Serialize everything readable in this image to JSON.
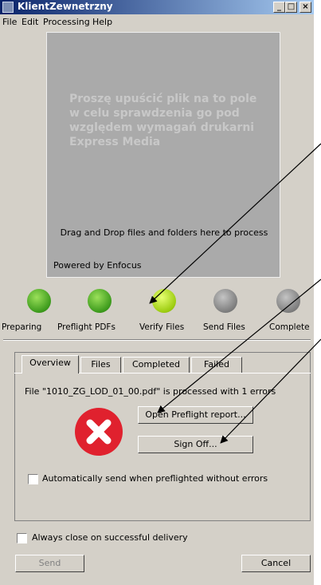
{
  "window": {
    "title": "KlientZewnetrzny",
    "controls": {
      "minimize": "_",
      "maximize": "□",
      "close": "×"
    }
  },
  "menu": [
    "File",
    "Edit",
    "Processing",
    "Help"
  ],
  "dropzone": {
    "polish_text": "Proszę upuścić plik na to pole w celu sprawdzenia go pod względem wymagań drukarni Express Media",
    "english_text": "Drag and Drop files and folders here to process",
    "powered_by": "Powered by Enfocus"
  },
  "steps": [
    {
      "label": "Preparing",
      "status": "done"
    },
    {
      "label": "Preflight PDFs",
      "status": "done"
    },
    {
      "label": "Verify Files",
      "status": "active"
    },
    {
      "label": "Send Files",
      "status": "pending"
    },
    {
      "label": "Complete",
      "status": "pending"
    }
  ],
  "tabs": [
    "Overview",
    "Files",
    "Completed",
    "Failed"
  ],
  "overview": {
    "status_text": "File \"1010_ZG_LOD_01_00.pdf\" is processed with 1 errors",
    "open_report_button": "Open Preflight report...",
    "sign_off_button": "Sign Off...",
    "auto_send_checkbox": "Automatically send when preflighted without errors",
    "auto_send_checked": false
  },
  "footer": {
    "always_close_checkbox": "Always close on successful delivery",
    "always_close_checked": false,
    "send_button": "Send",
    "cancel_button": "Cancel"
  },
  "colors": {
    "title_gradient_start": "#0a246a",
    "title_gradient_end": "#a6caf0",
    "window_bg": "#d4d0c8",
    "dropzone_bg": "#aaaaaa",
    "error_red": "#e0212e",
    "lamp_green": "#3c9a1c",
    "lamp_lime": "#9ccc10",
    "lamp_grey": "#7d7d7d"
  },
  "icons": {
    "error": "error-x-icon",
    "app": "app-icon"
  }
}
